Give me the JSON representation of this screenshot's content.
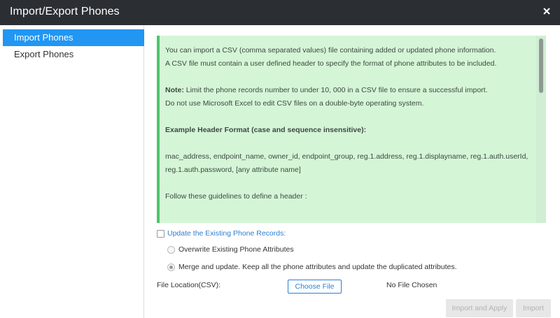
{
  "dialog": {
    "title": "Import/Export Phones",
    "close_icon": "close-icon"
  },
  "sidebar": {
    "items": [
      {
        "label": "Import Phones",
        "active": true
      },
      {
        "label": "Export Phones",
        "active": false
      }
    ]
  },
  "info": {
    "line1": "You can import a CSV (comma separated values) file containing added or updated phone information.",
    "line2": "A CSV file must contain a user defined header to specify the format of phone attributes to be included.",
    "note_label": "Note:",
    "note_text": " Limit the phone records number to under 10, 000 in a CSV file to ensure a successful import.",
    "note_line2": "Do not use Microsoft Excel to edit CSV files on a double-byte operating system.",
    "example_heading": "Example Header Format (case and sequence insensitive):",
    "example_line1": "mac_address, endpoint_name, owner_id, endpoint_group, reg.1.address, reg.1.displayname, reg.1.auth.userId,",
    "example_line2": "reg.1.auth.password, [any attribute name]",
    "guidelines": "Follow these guidelines to define a header :",
    "colors": {
      "background": "#d5f5d7",
      "accent": "#4cc56b"
    }
  },
  "update_option": {
    "checkbox_label": "Update the Existing Phone Records:",
    "checked": false,
    "radios": [
      {
        "label": "Overwrite Existing Phone Attributes",
        "checked": false
      },
      {
        "label": "Merge and update. Keep all the phone attributes and update the duplicated attributes.",
        "checked": true
      }
    ]
  },
  "file": {
    "label": "File Location(CSV):",
    "choose_button": "Choose File",
    "status": "No File Chosen"
  },
  "footer": {
    "import_apply": "Import and Apply",
    "import": "Import"
  },
  "colors": {
    "titlebar": "#2b2f34",
    "active_tab": "#2196f3",
    "link": "#2e7fd1"
  }
}
